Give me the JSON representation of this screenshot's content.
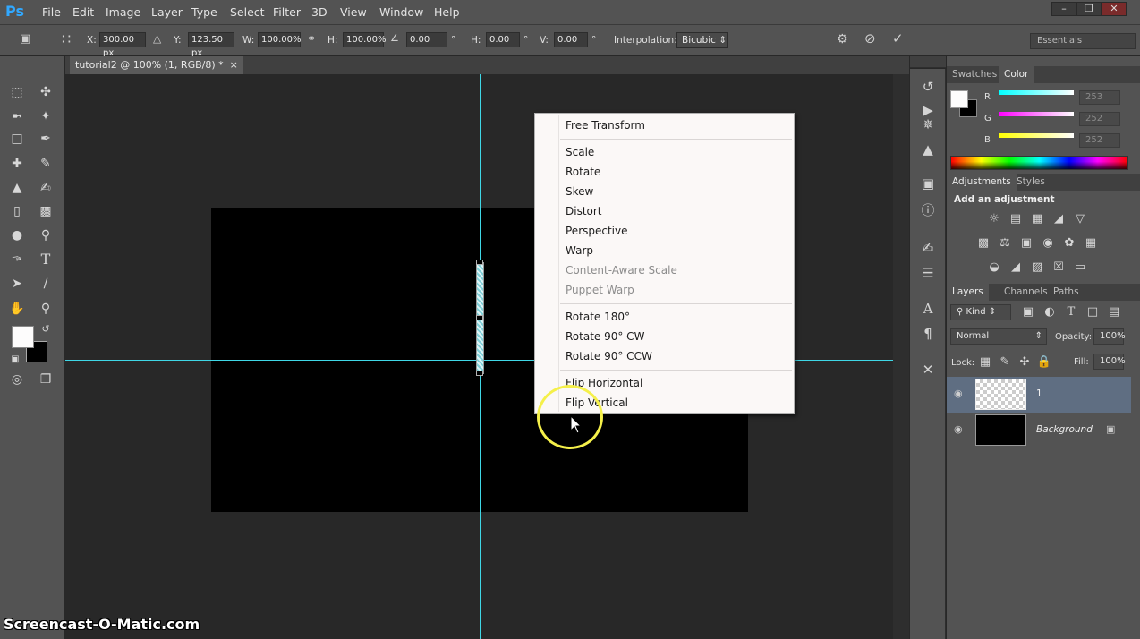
{
  "app": {
    "logo": "Ps",
    "menu": [
      "File",
      "Edit",
      "Image",
      "Layer",
      "Type",
      "Select",
      "Filter",
      "3D",
      "View",
      "Window",
      "Help"
    ],
    "window_controls": [
      "minimize",
      "restore",
      "close"
    ]
  },
  "options_bar": {
    "x_label": "X:",
    "x_value": "300.00 px",
    "y_label": "Y:",
    "y_value": "123.50 px",
    "w_label": "W:",
    "w_value": "100.00%",
    "h_label": "H:",
    "h_value": "100.00%",
    "angle_value": "0.00",
    "angle_unit": "°",
    "hskew_label": "H:",
    "hskew_value": "0.00",
    "hskew_unit": "°",
    "vskew_label": "V:",
    "vskew_value": "0.00",
    "vskew_unit": "°",
    "interp_label": "Interpolation:",
    "interp_value": "Bicubic",
    "workspace": "Essentials"
  },
  "document": {
    "tab_title": "tutorial2 @ 100% (1, RGB/8) *",
    "close_glyph": "×"
  },
  "context_menu": {
    "items": [
      {
        "label": "Free Transform",
        "enabled": true
      },
      {
        "label": "Scale",
        "enabled": true
      },
      {
        "label": "Rotate",
        "enabled": true
      },
      {
        "label": "Skew",
        "enabled": true
      },
      {
        "label": "Distort",
        "enabled": true
      },
      {
        "label": "Perspective",
        "enabled": true
      },
      {
        "label": "Warp",
        "enabled": true
      },
      {
        "label": "Content-Aware Scale",
        "enabled": false
      },
      {
        "label": "Puppet Warp",
        "enabled": false
      },
      {
        "label": "Rotate 180°",
        "enabled": true
      },
      {
        "label": "Rotate 90° CW",
        "enabled": true
      },
      {
        "label": "Rotate 90° CCW",
        "enabled": true
      },
      {
        "label": "Flip Horizontal",
        "enabled": true
      },
      {
        "label": "Flip Vertical",
        "enabled": true
      }
    ]
  },
  "color_panel": {
    "tabs": [
      "Swatches",
      "Color"
    ],
    "active_tab": "Color",
    "r_label": "R",
    "r_value": "253",
    "g_label": "G",
    "g_value": "252",
    "b_label": "B",
    "b_value": "252",
    "foreground": "#fdfcfc",
    "background": "#000000"
  },
  "adjustments_panel": {
    "tabs": [
      "Adjustments",
      "Styles"
    ],
    "title": "Add an adjustment"
  },
  "layers_panel": {
    "tabs": [
      "Layers",
      "Channels",
      "Paths"
    ],
    "filter_kind": "Kind",
    "blend_mode": "Normal",
    "opacity_label": "Opacity:",
    "opacity_value": "100%",
    "lock_label": "Lock:",
    "fill_label": "Fill:",
    "fill_value": "100%",
    "layers": [
      {
        "name": "1",
        "selected": true,
        "transparent": true
      },
      {
        "name": "Background",
        "selected": false,
        "locked": true
      }
    ]
  },
  "colors": {
    "accent_cyan": "#3fd7e6",
    "highlight_ring": "#f5f04a"
  },
  "watermark": "Screencast-O-Matic.com"
}
